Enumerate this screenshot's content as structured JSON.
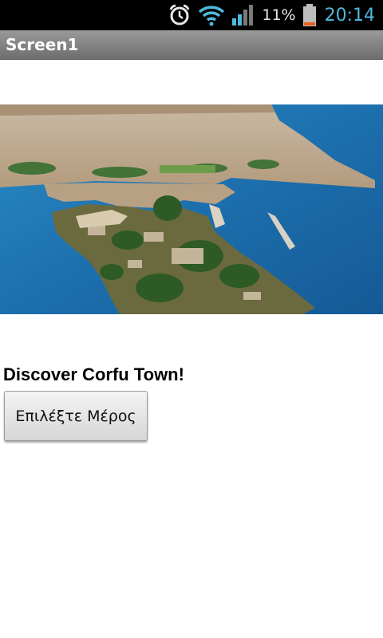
{
  "status_bar": {
    "battery_percent": "11%",
    "time": "20:14",
    "icons": [
      "alarm-icon",
      "wifi-icon",
      "signal-icon",
      "battery-icon"
    ],
    "clock_color": "#4fb8de",
    "battery_low_color": "#e8601c"
  },
  "title_bar": {
    "title": "Screen1"
  },
  "main": {
    "image_subject": "aerial-photo-corfu-old-fortress",
    "heading": "Discover Corfu Town!",
    "button_label": "Επιλέξτε Μέρος"
  }
}
